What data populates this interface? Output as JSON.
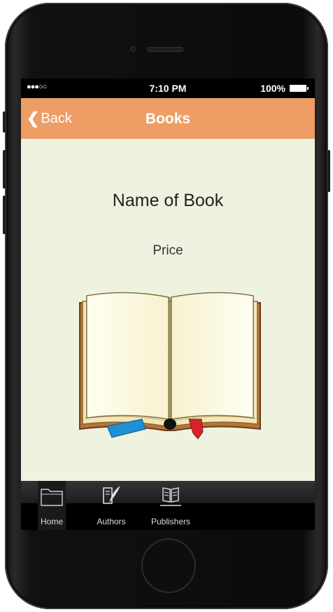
{
  "status": {
    "signal": "●●●○○",
    "time": "7:10 PM",
    "battery": "100%"
  },
  "nav": {
    "back_label": "Back",
    "title": "Books"
  },
  "content": {
    "book_name": "Name of Book",
    "price": "Price"
  },
  "tabs": [
    {
      "label": "Home",
      "icon": "folder-icon"
    },
    {
      "label": "Authors",
      "icon": "quill-icon"
    },
    {
      "label": "Publishers",
      "icon": "book-icon"
    }
  ],
  "colors": {
    "navbar": "#ee9d64",
    "background": "#eef3df"
  }
}
